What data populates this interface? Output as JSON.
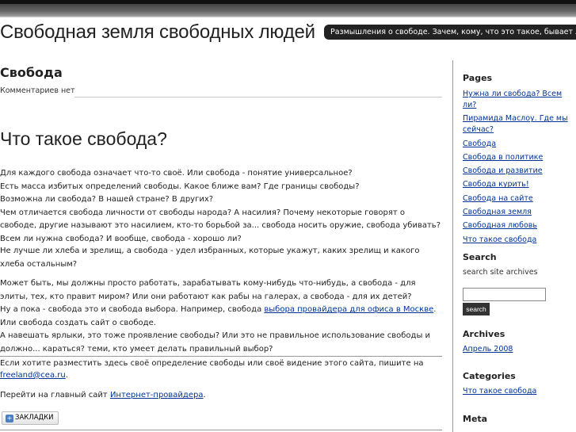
{
  "header": {
    "site_title": "Свободная земля свободных людей",
    "tagline": "Размышления о свободе. Зачем, кому, что это такое, бывает ли вообще?"
  },
  "post": {
    "title": "Свобода",
    "comments": "Комментариев нет",
    "heading": "Что такое свобода?",
    "p1_lines": [
      "Для каждого свобода означает что-то своё. Или свобода - понятие универсальное?",
      "Есть масса избитых определений свободы. Какое ближе вам? Где границы свободы?",
      "Возможна ли свобода? В нашей стране? В других?",
      "Чем отличается свобода личности от свободы народа? А насилия? Почему некоторые говорят о свободе, другие называют это насилием, кто-то борьбой за... свобода носить оружие, свобода убивать?",
      "Всем ли нужна свобода? И вообще, свобода - хорошо ли?"
    ],
    "p2": "Не лучше ли хлеба и зрелищ, а свобода - удел избранных, которые укажут, каких зрелищ и какого хлеба остальным?",
    "p3_line1": "Может быть, мы должны просто работать, зарабатывать кому-нибудь что-нибудь, а свобода - для элиты, тех, кто правит миром? Или они работают как рабы на галерах, а свобода - для их детей?",
    "p3_line2_pre": "Ну а пока - свобода это и свобода выбора. Например, свобода ",
    "p3_link": "выбора провайдера для офиса в Москве",
    "p3_line2_post": ".",
    "p3_line3": "Или свобода создать сайт о свободе.",
    "p3_line4": "А навешать ярлыки, это тоже проявление свободы? Или это не правильное использование свободы и должно... караться? теми, кто умеет делать правильный выбор?",
    "footer_pre": "Если хотите разместить здесь своё определение свободы или своё видение этого сайта, пишите на ",
    "footer_email": "freeland@cea.ru",
    "footer_post": ".",
    "footer2_pre": "Перейти на главный сайт ",
    "footer2_link": "Интернет-провайдера",
    "footer2_post": ".",
    "bookmark_label": "ЗАКЛАДКИ"
  },
  "sidebar": {
    "pages_title": "Pages",
    "pages": [
      "Нужна ли свобода? Всем ли?",
      "Пирамида Маслоу. Где мы сейчас?",
      "Свобода",
      "Свобода в политике",
      "Свобода и развитие",
      "Свобода курить!",
      "Свобода на сайте",
      "Свободная земля",
      "Свободная любовь",
      "Что такое свобода"
    ],
    "search_title": "Search",
    "search_desc": "search site archives",
    "search_value": "",
    "search_button": "search",
    "archives_title": "Archives",
    "archive_link": "Апрель 2008",
    "categories_title": "Categories",
    "category_link": "Что такое свобода",
    "meta_title": "Meta"
  }
}
